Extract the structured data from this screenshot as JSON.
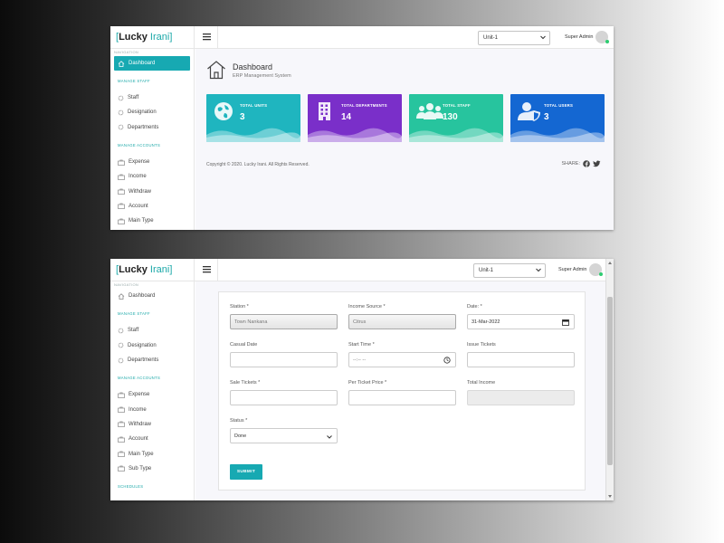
{
  "brand": {
    "bracket_open": "[",
    "name_dark": "Lucky ",
    "name_teal": "Irani",
    "bracket_close": "]"
  },
  "header": {
    "unit_select": "Unit-1",
    "user": "Super Admin"
  },
  "sidebar": {
    "nav_heading": "NAVIGATION",
    "dashboard": "Dashboard",
    "staff_heading": "MANAGE STAFF",
    "staff_items": [
      "Staff",
      "Designation",
      "Departments"
    ],
    "accounts_heading": "MANAGE ACCOUNTS",
    "account_items": [
      "Expense",
      "Income",
      "Withdraw",
      "Account",
      "Main Type",
      "Sub Type"
    ],
    "schedules_heading": "SCHEDULES"
  },
  "dashboard": {
    "title": "Dashboard",
    "subtitle": "ERP Management System",
    "cards": [
      {
        "label": "TOTAL UNITS",
        "value": "3",
        "color": "#1fb5bf"
      },
      {
        "label": "TOTAL DEPARTMENTS",
        "value": "14",
        "color": "#7a2fc9"
      },
      {
        "label": "TOTAL STAFF",
        "value": "130",
        "color": "#27c49e"
      },
      {
        "label": "TOTAL USERS",
        "value": "3",
        "color": "#1467d2"
      }
    ],
    "copyright": "Copyright © 2020. Lucky Irani. All Rights Reserved.",
    "share": "SHARE:"
  },
  "form": {
    "station_label": "Station *",
    "station_value": "Town Nankana",
    "income_source_label": "Income Source *",
    "income_source_value": "Citrus",
    "date_label": "Date: *",
    "date_value": "31-Mar-2022",
    "casual_date_label": "Casual Date",
    "start_time_label": "Start Time *",
    "start_time_value": "--:-- --",
    "issue_tickets_label": "Issue Tickets",
    "sale_tickets_label": "Sale Tickets *",
    "per_ticket_price_label": "Per Ticket Price *",
    "total_income_label": "Total Income",
    "status_label": "Status *",
    "status_value": "Done",
    "submit": "SUBMIT"
  },
  "colors": {
    "accent": "#17a9b2",
    "online": "#2ecc71"
  }
}
